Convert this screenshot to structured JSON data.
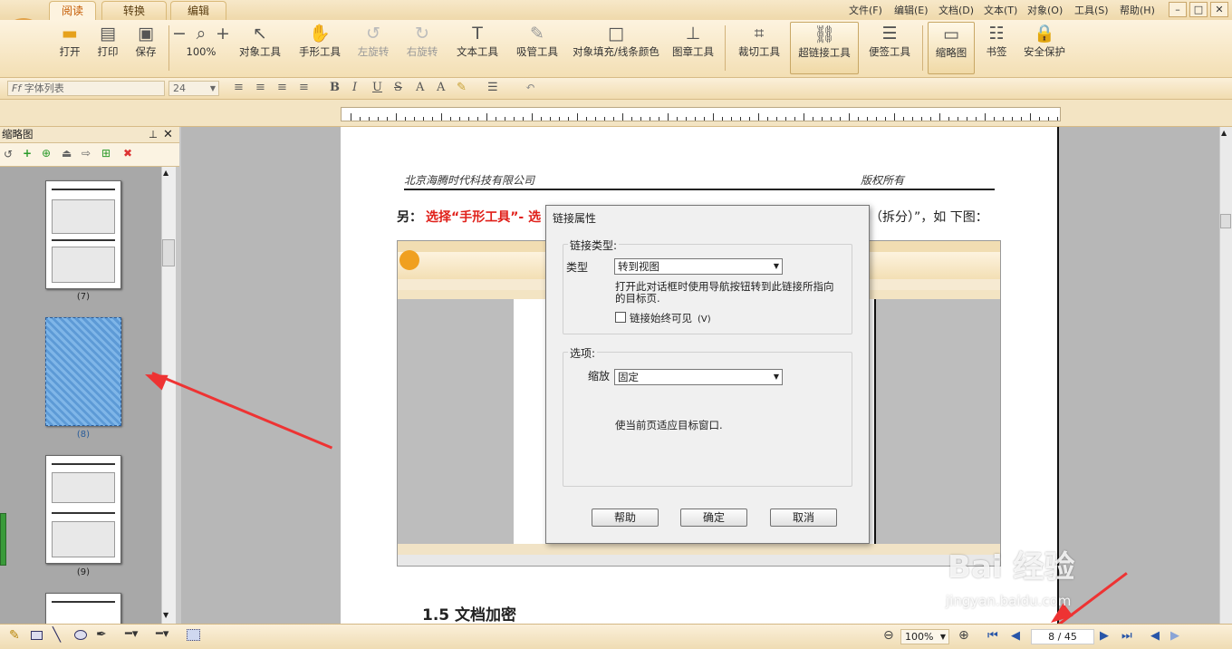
{
  "tabs": [
    "阅读",
    "转换",
    "编辑"
  ],
  "menu": [
    "文件(F)",
    "编辑(E)",
    "文档(D)",
    "文本(T)",
    "对象(O)",
    "工具(S)",
    "帮助(H)"
  ],
  "tools": {
    "open": "打开",
    "print": "打印",
    "save": "保存",
    "zoom": "100%",
    "object_tool": "对象工具",
    "hand_tool": "手形工具",
    "rotate_left": "左旋转",
    "rotate_right": "右旋转",
    "text_tool": "文本工具",
    "eyedropper": "吸管工具",
    "fill_color": "对象填充/线条颜色",
    "stamp": "图章工具",
    "crop": "裁切工具",
    "hyperlink": "超链接工具",
    "note": "便签工具",
    "thumbnail": "缩略图",
    "bookmark": "书签",
    "security": "安全保护"
  },
  "format": {
    "font_list": "字体列表",
    "font_size": "24"
  },
  "panel": {
    "title": "缩略图",
    "thumbs": [
      "(7)",
      "(8)",
      "(9)"
    ]
  },
  "document": {
    "header_left": "北京海腾时代科技有限公司",
    "header_right": "版权所有",
    "line_lead": "另：",
    "line_red": "选择“手形工具”- 选",
    "line_tail": "（拆分）”，如 下图：",
    "section": "1.5 文档加密"
  },
  "dialog": {
    "title": "链接属性",
    "group1": "链接类型:",
    "type_label": "类型",
    "type_value": "转到视图",
    "desc": "打开此对话框时使用导航按钮转到此链接所指向的目标页.",
    "checkbox": "链接始终可见",
    "checkbox_key": "(V)",
    "group2": "选项:",
    "zoom_label": "缩放",
    "zoom_value": "固定",
    "zoom_desc": "使当前页适应目标窗口.",
    "help": "帮助",
    "ok": "确定",
    "cancel": "取消"
  },
  "status": {
    "zoom": "100%",
    "page": "8 / 45"
  },
  "watermark": {
    "brand": "Bai  经验",
    "url": "jingyan.baidu.com"
  },
  "colors": {
    "accent": "#c45a00",
    "arrow": "#ee3333",
    "link_red": "#e0201a"
  }
}
